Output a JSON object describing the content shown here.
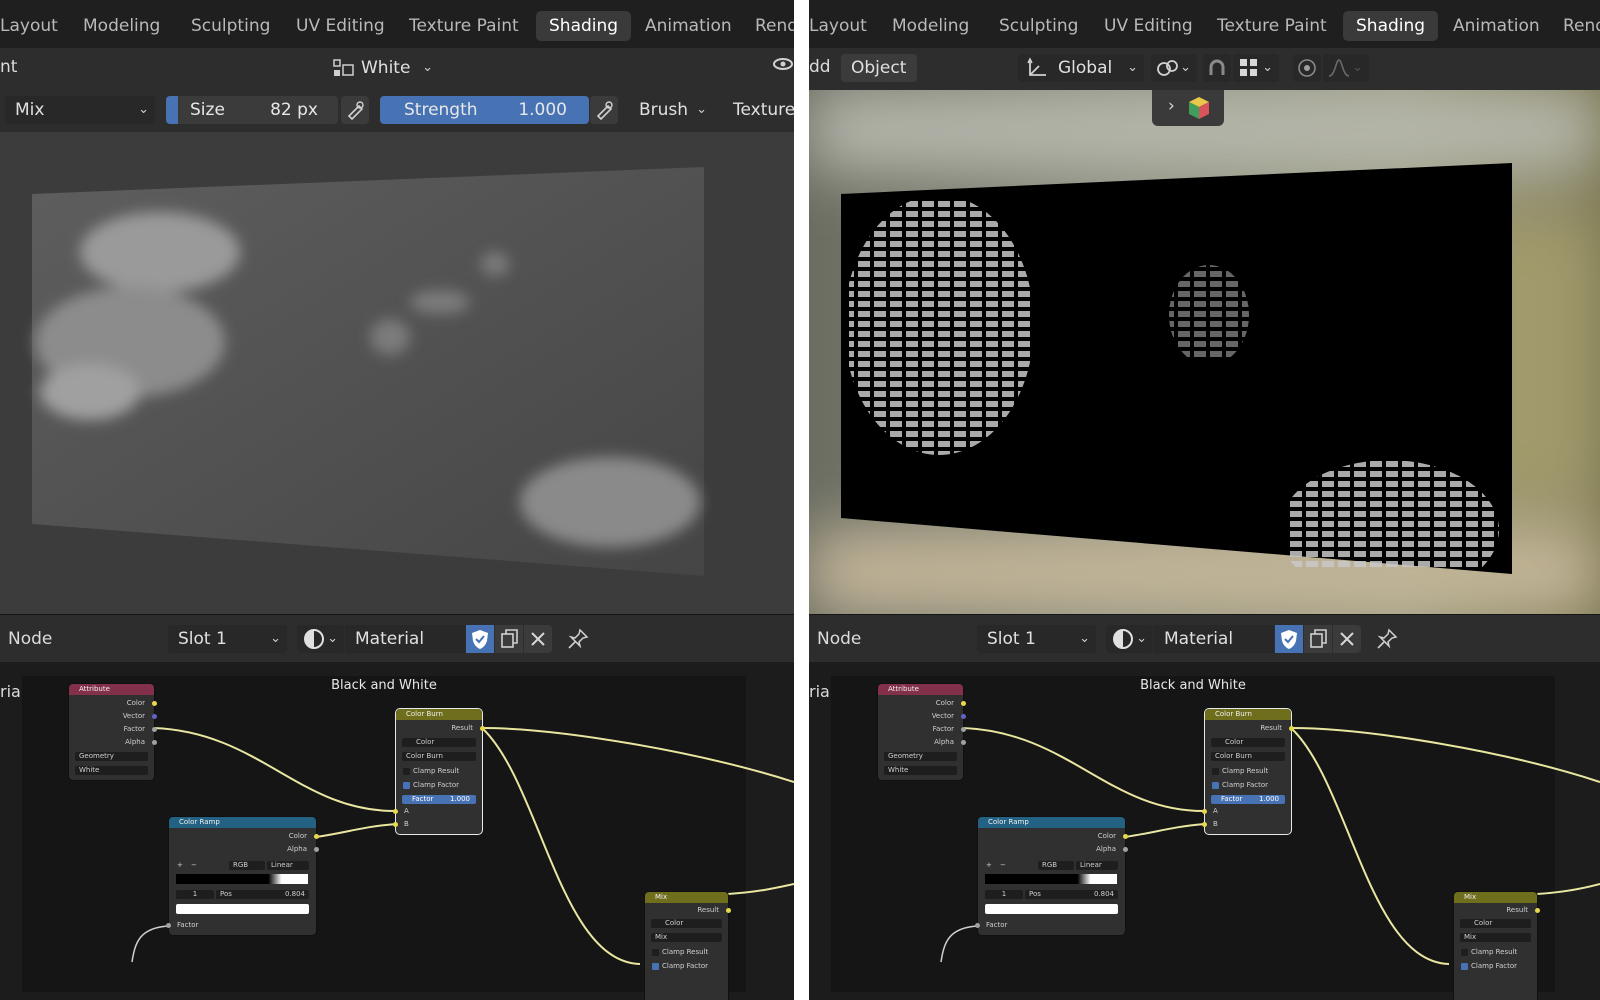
{
  "workspace_tabs": {
    "layout": "Layout",
    "modeling": "Modeling",
    "sculpting": "Sculpting",
    "uv_editing": "UV Editing",
    "texture_paint": "Texture Paint",
    "shading": "Shading",
    "animation": "Animation",
    "rendering_cut": "Rend"
  },
  "left": {
    "header_cut_text": "nt",
    "attribute_dropdown": "White",
    "blend_mode": "Mix",
    "size_label": "Size",
    "size_value": "82 px",
    "strength_label": "Strength",
    "strength_value": "1.000",
    "brush_label": "Brush",
    "texture_label": "Texture"
  },
  "right": {
    "header_cut_text": "dd",
    "object_menu": "Object",
    "transform_orientation": "Global"
  },
  "node_header": {
    "editor_label": "Node",
    "slot": "Slot 1",
    "material_name": "Material"
  },
  "node_editor": {
    "material_cut_label": "rial",
    "frame_label": "Black and White",
    "attribute_node": {
      "title": "Attribute",
      "outputs": [
        "Color",
        "Vector",
        "Factor",
        "Alpha"
      ],
      "type": "Geometry",
      "name": "White"
    },
    "color_ramp_node": {
      "title": "Color Ramp",
      "outputs": [
        "Color",
        "Alpha"
      ],
      "plus": "+",
      "minus": "−",
      "mode": "RGB",
      "interpolation": "Linear",
      "stop_index": "1",
      "pos_label": "Pos",
      "pos_value": "0.804",
      "input": "Factor"
    },
    "color_burn_node": {
      "title": "Color Burn",
      "output": "Result",
      "data_type": "Color",
      "blend_type": "Color Burn",
      "clamp_result": "Clamp Result",
      "clamp_factor": "Clamp Factor",
      "factor_label": "Factor",
      "factor_value": "1.000",
      "input_a": "A",
      "input_b": "B"
    },
    "mix_node": {
      "title": "Mix",
      "output": "Result",
      "data_type": "Color",
      "blend_type": "Mix",
      "clamp_result": "Clamp Result",
      "clamp_factor": "Clamp Factor"
    }
  },
  "colors": {
    "accent_blue": "#4772b3",
    "attribute_header": "#83314a",
    "color_ramp_header": "#246283",
    "color_burn_header": "#6e6e1d",
    "link_yellow": "#e8e6a0"
  },
  "icons": [
    "color-attribute-icon",
    "eye-icon",
    "brush-pressure-icon",
    "transform-orientation-icon",
    "link-icon",
    "snap-icon",
    "snap-grid-icon",
    "proportional-edit-icon",
    "falloff-icon",
    "gizmo-expand-icon",
    "color-cube-icon",
    "shading-sphere-icon",
    "fake-user-shield-icon",
    "duplicate-icon",
    "close-icon",
    "pin-icon"
  ]
}
